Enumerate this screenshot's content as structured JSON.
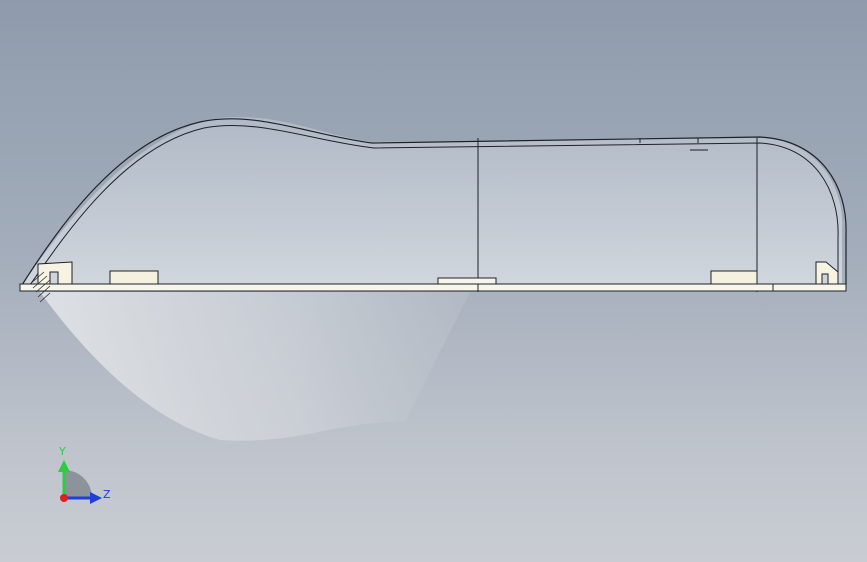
{
  "view": {
    "background_top": "#8f9bac",
    "background_bottom": "#c9cdd3"
  },
  "triad": {
    "y_label": "Y",
    "z_label": "Z",
    "y_color": "#2ecc40",
    "z_color": "#1f3fd8",
    "x_color": "#e02020"
  },
  "icons": {
    "triad": "view-orientation-triad-icon"
  }
}
